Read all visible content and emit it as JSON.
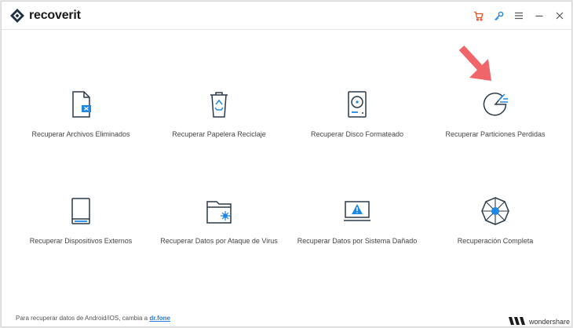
{
  "app": {
    "name_main": "recover",
    "name_suffix": "it",
    "accent": "#1e88e5",
    "cart_color": "#e8542a"
  },
  "toolbar": {
    "icons": [
      "cart-icon",
      "key-icon",
      "menu-icon",
      "minimize-icon",
      "close-icon"
    ]
  },
  "tiles": [
    {
      "label": "Recuperar Archivos Eliminados",
      "icon": "deleted-file-icon"
    },
    {
      "label": "Recuperar Papelera Reciclaje",
      "icon": "recycle-bin-icon"
    },
    {
      "label": "Recuperar Disco Formateado",
      "icon": "hard-disk-icon"
    },
    {
      "label": "Recuperar Particiones Perdidas",
      "icon": "partition-icon"
    },
    {
      "label": "Recuperar Dispositivos Externos",
      "icon": "external-device-icon"
    },
    {
      "label": "Recuperar Datos por Ataque de Virus",
      "icon": "virus-folder-icon"
    },
    {
      "label": "Recuperar Datos por Sistema Dañado",
      "icon": "crashed-system-icon"
    },
    {
      "label": "Recuperación Completa",
      "icon": "all-around-icon"
    }
  ],
  "footer": {
    "text": "Para recuperar datos de Android/iOS, cambia a ",
    "link": "dr.fone"
  },
  "brand": {
    "name": "wondershare"
  }
}
